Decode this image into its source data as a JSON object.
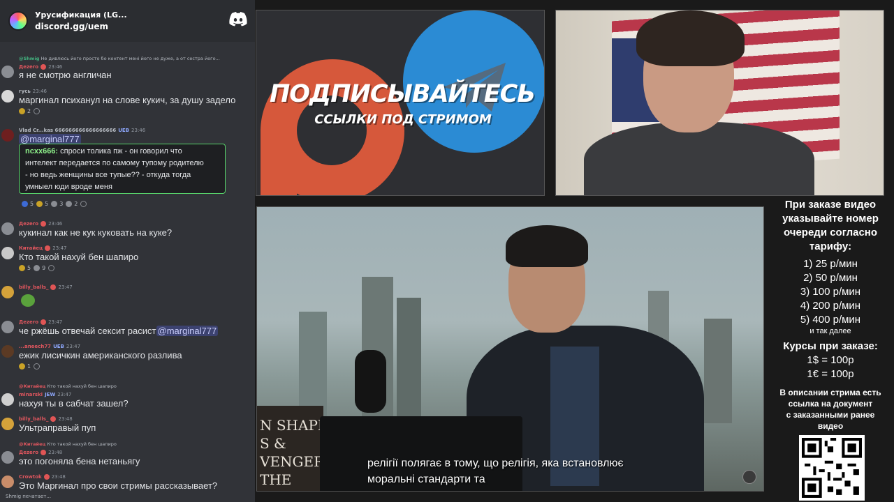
{
  "discord": {
    "server_name": "Урусификация (LG...",
    "invite": "discord.gg/uem"
  },
  "chat": [
    {
      "reply_name": "@Shmig",
      "reply_text": "Не дивлюсь його просто бо контент мені його не дуже, а от сестра його..."
    },
    {
      "name": "Дezero",
      "name_color": "#e0565e",
      "time": "23:46",
      "text": "я не смотрю англичан"
    },
    {
      "name": "гусь",
      "name_color": "#b5bac1",
      "time": "23:46",
      "text": "маргинал психанул на слове кукич, за душу задело",
      "reactions": [
        "2"
      ]
    },
    {
      "name": "Vlad Cr...kas 666666666666666666",
      "name_color": "#b5bac1",
      "badge": "UEB",
      "time": "23:46",
      "mention": "@marginal777"
    },
    {
      "quote_name": "ncxx666:",
      "quote_lines": [
        "спроси толика пж - он говорил что",
        "интелект передается по самому тупому родителю",
        "- но ведь женщины все тупые?? - откуда тогда",
        "умныел юди вроде меня"
      ]
    },
    {
      "reactions_row": [
        "5",
        "5",
        "3",
        "2"
      ]
    },
    {
      "name": "Дezero",
      "name_color": "#e0565e",
      "time": "23:46",
      "text": "кукинал как не кук куковать на куке?"
    },
    {
      "name": "Китайец",
      "name_color": "#e0565e",
      "time": "23:47",
      "text": "Кто такой нахуй бен шапиро",
      "reactions": [
        "5",
        "9"
      ]
    },
    {
      "name": "billy_balls_",
      "name_color": "#e0565e",
      "time": "23:47"
    },
    {
      "name": "Дezero",
      "name_color": "#e0565e",
      "time": "23:47",
      "text": "че ржёшь отвечай сексит расист",
      "mention": "@marginal777"
    },
    {
      "name": "...aneech77",
      "name_color": "#e0565e",
      "badge": "UEB",
      "time": "23:47",
      "text": "ежик лисичкин американского разлива",
      "reactions": [
        "1"
      ]
    },
    {
      "reply_name": "@Китайец",
      "reply_text": "Кто такой нахуй бен шапиро"
    },
    {
      "name": "minarski",
      "name_color": "#e0565e",
      "badge": "JEW",
      "time": "23:47",
      "text": "нахуя ты в сабчат зашел?"
    },
    {
      "name": "billy_balls_",
      "name_color": "#e0565e",
      "time": "23:48",
      "text": "Ультраправый пуп"
    },
    {
      "reply_name": "@Китайец",
      "reply_text": "Кто такой нахуй бен шапиро"
    },
    {
      "name": "Дezero",
      "name_color": "#e0565e",
      "time": "23:48",
      "text": "это погоняла бена нетаньягу"
    },
    {
      "name": "Crowtok",
      "name_color": "#e0565e",
      "time": "23:48",
      "text": "Это Маргинал про свои стримы рассказывает?"
    }
  ],
  "typing": "Shmig печатает...",
  "promo": {
    "title": "ПОДПИСЫВАЙТЕСЬ",
    "subtitle": "ССЫЛКИ ПОД СТРИМОМ"
  },
  "subtitles": [
    "релігії полягає в тому, що релігія, яка встановлює",
    "моральні стандарти та"
  ],
  "book_text": "N SHAPIRO\nS &\nVENGERS\nTHE",
  "info": {
    "head": [
      "При заказе видео",
      "указывайте номер",
      "очереди согласно",
      "тарифу:"
    ],
    "tariffs": [
      "1) 25 р/мин",
      "2) 50 р/мин",
      "3) 100 р/мин",
      "4) 200 р/мин",
      "5) 400 р/мин"
    ],
    "etc": "и так далее",
    "courses_head": "Курсы при заказе:",
    "courses": [
      "1$ = 100р",
      "1€ = 100р"
    ],
    "desc": [
      "В описании стрима есть",
      "ссылка на документ",
      "с заказанными ранее",
      "видео"
    ]
  }
}
